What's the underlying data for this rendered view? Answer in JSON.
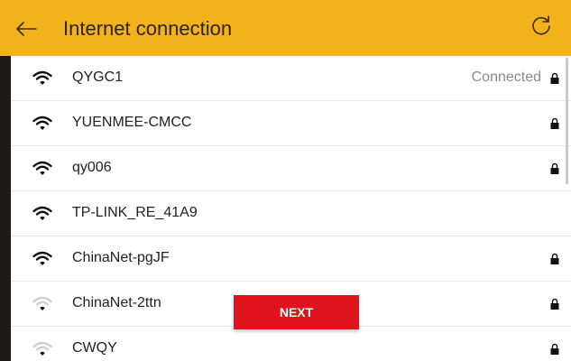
{
  "header": {
    "title": "Internet connection",
    "back_icon": "back-arrow-icon",
    "refresh_icon": "refresh-icon",
    "color": "#f2b21b"
  },
  "networks": [
    {
      "ssid": "QYGC1",
      "status": "Connected",
      "locked": true,
      "signal": "full"
    },
    {
      "ssid": "YUENMEE-CMCC",
      "status": "",
      "locked": true,
      "signal": "full"
    },
    {
      "ssid": "qy006",
      "status": "",
      "locked": true,
      "signal": "full"
    },
    {
      "ssid": "TP-LINK_RE_41A9",
      "status": "",
      "locked": false,
      "signal": "full"
    },
    {
      "ssid": "ChinaNet-pgJF",
      "status": "",
      "locked": true,
      "signal": "full"
    },
    {
      "ssid": "ChinaNet-2ttn",
      "status": "",
      "locked": true,
      "signal": "weak"
    },
    {
      "ssid": "CWQY",
      "status": "",
      "locked": true,
      "signal": "weak"
    }
  ],
  "next_button": {
    "label": "NEXT",
    "color": "#e0141d"
  }
}
